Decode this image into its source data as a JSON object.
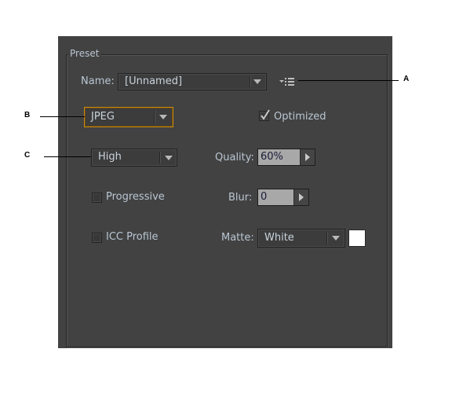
{
  "group": {
    "title": "Preset"
  },
  "name_row": {
    "label": "Name:",
    "value": "[Unnamed]"
  },
  "preset_menu_icon": "options-menu-icon",
  "format": {
    "value": "JPEG"
  },
  "optimized": {
    "label": "Optimized",
    "checked": true
  },
  "quality_preset": {
    "value": "High"
  },
  "quality": {
    "label": "Quality:",
    "value": "60%"
  },
  "progressive": {
    "label": "Progressive",
    "checked": false
  },
  "blur": {
    "label": "Blur:",
    "value": "0"
  },
  "icc_profile": {
    "label": "ICC Profile",
    "checked": false
  },
  "matte": {
    "label": "Matte:",
    "value": "White",
    "swatch_color": "#ffffff"
  },
  "callouts": {
    "a": "A",
    "b": "B",
    "c": "C"
  },
  "colors": {
    "panel": "#424242",
    "focus_border": "#c98a12",
    "label_text": "#b9c6d3"
  }
}
